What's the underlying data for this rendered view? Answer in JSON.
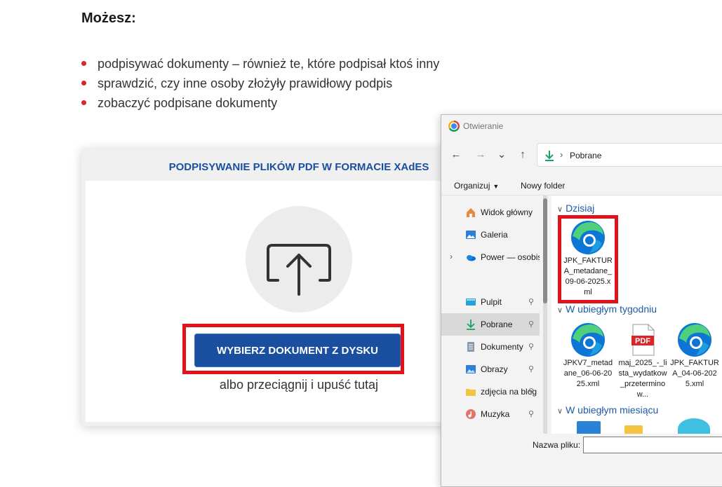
{
  "page": {
    "heading": "Możesz:",
    "bullets": [
      "podpisywać dokumenty – również te, które podpisał ktoś inny",
      "sprawdzić, czy inne osoby złożyły prawidłowy podpis",
      "zobaczyć podpisane dokumenty"
    ],
    "accent_color": "#d92429",
    "brand_color": "#1a4fa0"
  },
  "upload_card": {
    "title": "PODPISYWANIE PLIKÓW PDF W FORMACIE XAdES",
    "upload_icon": "upload-icon",
    "button_label": "WYBIERZ DOKUMENT Z DYSKU",
    "drop_hint": "albo przeciągnij i upuść tutaj"
  },
  "dialog": {
    "title": "Otwieranie",
    "app_icon": "chrome-icon",
    "nav": {
      "back": "←",
      "forward": "→",
      "recent": "⌄",
      "up": "↑"
    },
    "address": {
      "separator": "›",
      "location": "Pobrane"
    },
    "toolbar": {
      "organize": "Organizuj",
      "new_folder": "Nowy folder"
    },
    "nav_pane": [
      {
        "label": "Widok główny",
        "icon": "home-icon",
        "pinned": false
      },
      {
        "label": "Galeria",
        "icon": "gallery-icon",
        "pinned": false
      },
      {
        "label": "Power — osobisty",
        "icon": "onedrive-icon",
        "pinned": false,
        "expandable": true
      },
      {
        "label": "Pulpit",
        "icon": "desktop-icon",
        "pinned": true
      },
      {
        "label": "Pobrane",
        "icon": "download-icon",
        "pinned": true,
        "selected": true
      },
      {
        "label": "Dokumenty",
        "icon": "documents-icon",
        "pinned": true
      },
      {
        "label": "Obrazy",
        "icon": "pictures-icon",
        "pinned": true
      },
      {
        "label": "zdjęcia na blog",
        "icon": "folder-icon",
        "pinned": true
      },
      {
        "label": "Muzyka",
        "icon": "music-icon",
        "pinned": true
      }
    ],
    "pin_glyph": "📌",
    "groups": [
      {
        "header": "Dzisiaj",
        "files": [
          {
            "name": "JPK_FAKTURA_metadane_09-06-2025.xml",
            "icon": "edge-icon"
          }
        ]
      },
      {
        "header": "W ubiegłym tygodniu",
        "files": [
          {
            "name": "JPKV7_metadane_06-06-2025.xml",
            "icon": "edge-icon"
          },
          {
            "name": "maj_2025_-_lista_wydatkow_przeterminow...",
            "icon": "pdf-icon"
          },
          {
            "name": "JPK_FAKTURA_04-06-2025.xml",
            "icon": "edge-icon"
          }
        ]
      },
      {
        "header": "W ubiegłym miesiącu",
        "files": []
      }
    ],
    "pdf_badge": "PDF",
    "filename_label": "Nazwa pliku:",
    "filename_value": ""
  }
}
